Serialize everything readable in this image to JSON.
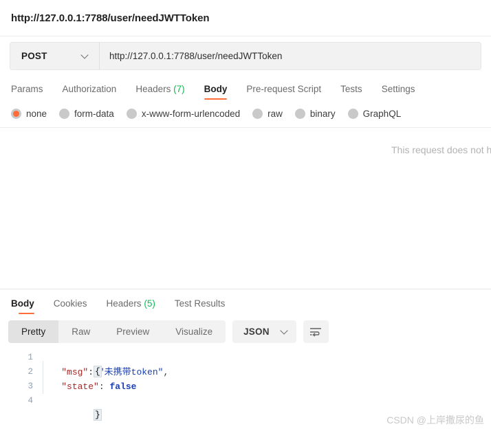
{
  "request": {
    "title": "http://127.0.0.1:7788/user/needJWTToken",
    "method": "POST",
    "url": "http://127.0.0.1:7788/user/needJWTToken",
    "tabs": [
      {
        "label": "Params",
        "count": "",
        "active": false
      },
      {
        "label": "Authorization",
        "count": "",
        "active": false
      },
      {
        "label": "Headers",
        "count": "(7)",
        "active": false
      },
      {
        "label": "Body",
        "count": "",
        "active": true
      },
      {
        "label": "Pre-request Script",
        "count": "",
        "active": false
      },
      {
        "label": "Tests",
        "count": "",
        "active": false
      },
      {
        "label": "Settings",
        "count": "",
        "active": false
      }
    ],
    "body_types": [
      {
        "label": "none",
        "selected": true
      },
      {
        "label": "form-data",
        "selected": false
      },
      {
        "label": "x-www-form-urlencoded",
        "selected": false
      },
      {
        "label": "raw",
        "selected": false
      },
      {
        "label": "binary",
        "selected": false
      },
      {
        "label": "GraphQL",
        "selected": false
      }
    ],
    "empty_body_message": "This request does not have a body"
  },
  "response": {
    "tabs": [
      {
        "label": "Body",
        "count": "",
        "active": true
      },
      {
        "label": "Cookies",
        "count": "",
        "active": false
      },
      {
        "label": "Headers",
        "count": "(5)",
        "active": false
      },
      {
        "label": "Test Results",
        "count": "",
        "active": false
      }
    ],
    "viewer_modes": [
      {
        "label": "Pretty",
        "active": true
      },
      {
        "label": "Raw",
        "active": false
      },
      {
        "label": "Preview",
        "active": false
      },
      {
        "label": "Visualize",
        "active": false
      }
    ],
    "format": "JSON",
    "wrap_icon": "word-wrap-icon",
    "code": {
      "line_numbers": [
        "1",
        "2",
        "3",
        "4"
      ],
      "open_brace": "{",
      "close_brace": "}",
      "entries": [
        {
          "key": "\"msg\"",
          "colon": ": ",
          "value": "\"未携带token\"",
          "value_type": "string",
          "comma": ","
        },
        {
          "key": "\"state\"",
          "colon": ": ",
          "value": "false",
          "value_type": "boolean",
          "comma": ""
        }
      ]
    }
  },
  "watermark": "CSDN @上岸撒尿的鱼",
  "colors": {
    "accent": "#ff6c37",
    "count_green": "#0cbb52",
    "json_key": "#a52727",
    "json_string": "#1a3fb0",
    "json_boolean": "#1a3fb0",
    "panel_gray": "#f2f2f2"
  }
}
